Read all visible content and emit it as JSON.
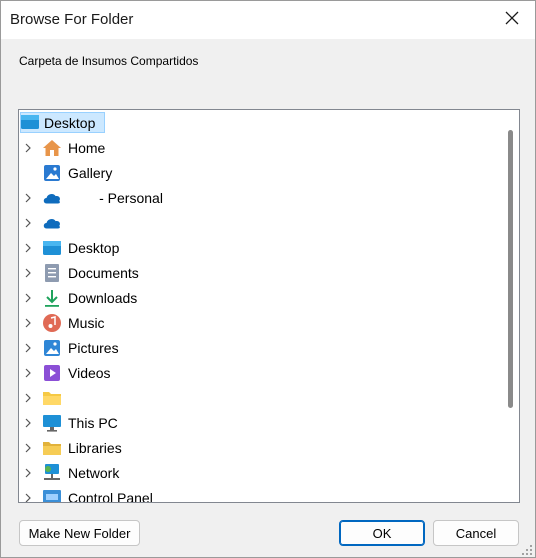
{
  "window": {
    "title": "Browse For Folder",
    "close_icon": "close-icon"
  },
  "instruction": "Carpeta de Insumos Compartidos",
  "tree": {
    "root": {
      "label": "Desktop",
      "icon": "desktop-icon"
    },
    "items": [
      {
        "label": "Home",
        "icon": "home-icon",
        "expandable": true
      },
      {
        "label": "Gallery",
        "icon": "gallery-icon",
        "expandable": false
      },
      {
        "label": "        - Personal",
        "icon": "onedrive-icon",
        "expandable": true
      },
      {
        "label": "",
        "icon": "onedrive-icon",
        "expandable": true
      },
      {
        "label": "Desktop",
        "icon": "desktop-icon",
        "expandable": true
      },
      {
        "label": "Documents",
        "icon": "documents-icon",
        "expandable": true
      },
      {
        "label": "Downloads",
        "icon": "downloads-icon",
        "expandable": true
      },
      {
        "label": "Music",
        "icon": "music-icon",
        "expandable": true
      },
      {
        "label": "Pictures",
        "icon": "pictures-icon",
        "expandable": true
      },
      {
        "label": "Videos",
        "icon": "videos-icon",
        "expandable": true
      },
      {
        "label": "",
        "icon": "folder-icon",
        "expandable": true
      },
      {
        "label": "This PC",
        "icon": "this-pc-icon",
        "expandable": true
      },
      {
        "label": "Libraries",
        "icon": "libraries-icon",
        "expandable": true
      },
      {
        "label": "Network",
        "icon": "network-icon",
        "expandable": true
      },
      {
        "label": "Control Panel",
        "icon": "control-panel-icon",
        "expandable": true
      }
    ]
  },
  "buttons": {
    "new_folder": "Make New Folder",
    "ok": "OK",
    "cancel": "Cancel"
  },
  "colors": {
    "selection_bg": "#cce8ff",
    "selection_border": "#99d1ff",
    "accent": "#0067c0"
  }
}
